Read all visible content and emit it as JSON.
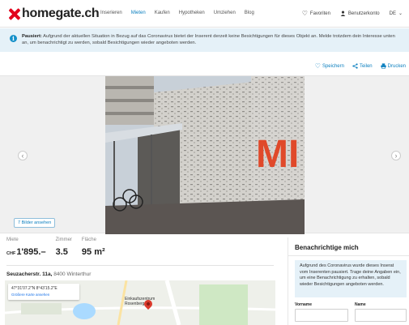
{
  "header": {
    "logo_text": "homegate.ch",
    "nav": [
      {
        "label": "Inserieren",
        "active": false
      },
      {
        "label": "Mieten",
        "active": true
      },
      {
        "label": "Kaufen",
        "active": false
      },
      {
        "label": "Hypotheken",
        "active": false
      },
      {
        "label": "Umziehen",
        "active": false
      },
      {
        "label": "Blog",
        "active": false
      }
    ],
    "favorites_label": "Favoriten",
    "account_label": "Benutzerkonto",
    "language": "DE"
  },
  "notice": {
    "icon": "info-icon",
    "bold": "Pausiert:",
    "text": "Aufgrund der aktuellen Situation in Bezug auf das Coronavirus bietet der Inserent derzeit keine Besichtigungen für dieses Objekt an. Melde trotzdem dein Interesse unten an, um benachrichtigt zu werden, sobald Besichtigungen wieder angeboten werden."
  },
  "actions": {
    "save_label": "Speichern",
    "share_label": "Teilen",
    "print_label": "Drucken"
  },
  "gallery": {
    "view_images_label": "7 Bilder ansehen",
    "prev_icon": "chevron-left-icon",
    "next_icon": "chevron-right-icon",
    "sign_text": "MI"
  },
  "facts": {
    "rent_label": "Miete",
    "rent_currency": "CHF",
    "rent_value": "1'895.–",
    "rooms_label": "Zimmer",
    "rooms_value": "3.5",
    "area_label": "Fläche",
    "area_value": "95 m²"
  },
  "address": {
    "street": "Seuzacherstr. 11a,",
    "city": "8400 Winterthur"
  },
  "map": {
    "coords": "47°31'07.2\"N 8°43'15.2\"E",
    "link_label": "Größere Karte ansehen",
    "poi_name": "Einkaufszentrum",
    "poi_name2": "Rosenberg"
  },
  "contact": {
    "title": "Benachrichtige mich",
    "info": "Aufgrund des Coronavirus wurde dieses Inserat vom Inserenten pausiert. Trage deine Angaben ein, um eine Benachrichtigung zu erhalten, sobald wieder Besichtigungen angeboten werden.",
    "firstname_label": "Vorname",
    "lastname_label": "Name",
    "firstname_value": "",
    "lastname_value": ""
  }
}
